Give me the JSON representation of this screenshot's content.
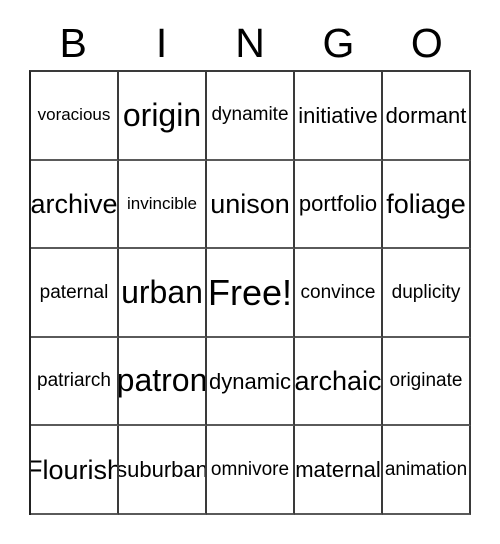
{
  "card": {
    "title": "BINGO",
    "headers": [
      "B",
      "I",
      "N",
      "G",
      "O"
    ],
    "grid_columns": 5,
    "grid_rows": 5,
    "colors": {
      "text": "#000000",
      "grid_line": "#3a3a3a",
      "background": "#ffffff"
    },
    "rows": [
      [
        {
          "text": "voracious",
          "size": "fs-s"
        },
        {
          "text": "origin",
          "size": "fs-xxl"
        },
        {
          "text": "dynamite",
          "size": "fs-m"
        },
        {
          "text": "initiative",
          "size": "fs-l"
        },
        {
          "text": "dormant",
          "size": "fs-l"
        }
      ],
      [
        {
          "text": "archive",
          "size": "fs-xl"
        },
        {
          "text": "invincible",
          "size": "fs-s"
        },
        {
          "text": "unison",
          "size": "fs-xl"
        },
        {
          "text": "portfolio",
          "size": "fs-l"
        },
        {
          "text": "foliage",
          "size": "fs-xl"
        }
      ],
      [
        {
          "text": "paternal",
          "size": "fs-m"
        },
        {
          "text": "urban",
          "size": "fs-xxl"
        },
        {
          "text": "Free!",
          "size": "fs-free"
        },
        {
          "text": "convince",
          "size": "fs-m"
        },
        {
          "text": "duplicity",
          "size": "fs-m"
        }
      ],
      [
        {
          "text": "patriarch",
          "size": "fs-m"
        },
        {
          "text": "patron",
          "size": "fs-xxl"
        },
        {
          "text": "dynamic",
          "size": "fs-l"
        },
        {
          "text": "archaic",
          "size": "fs-xl"
        },
        {
          "text": "originate",
          "size": "fs-m"
        }
      ],
      [
        {
          "text": "Flourish",
          "size": "fs-xl"
        },
        {
          "text": "suburban",
          "size": "fs-l"
        },
        {
          "text": "omnivore",
          "size": "fs-m"
        },
        {
          "text": "maternal",
          "size": "fs-l"
        },
        {
          "text": "animation",
          "size": "fs-m"
        }
      ]
    ]
  }
}
